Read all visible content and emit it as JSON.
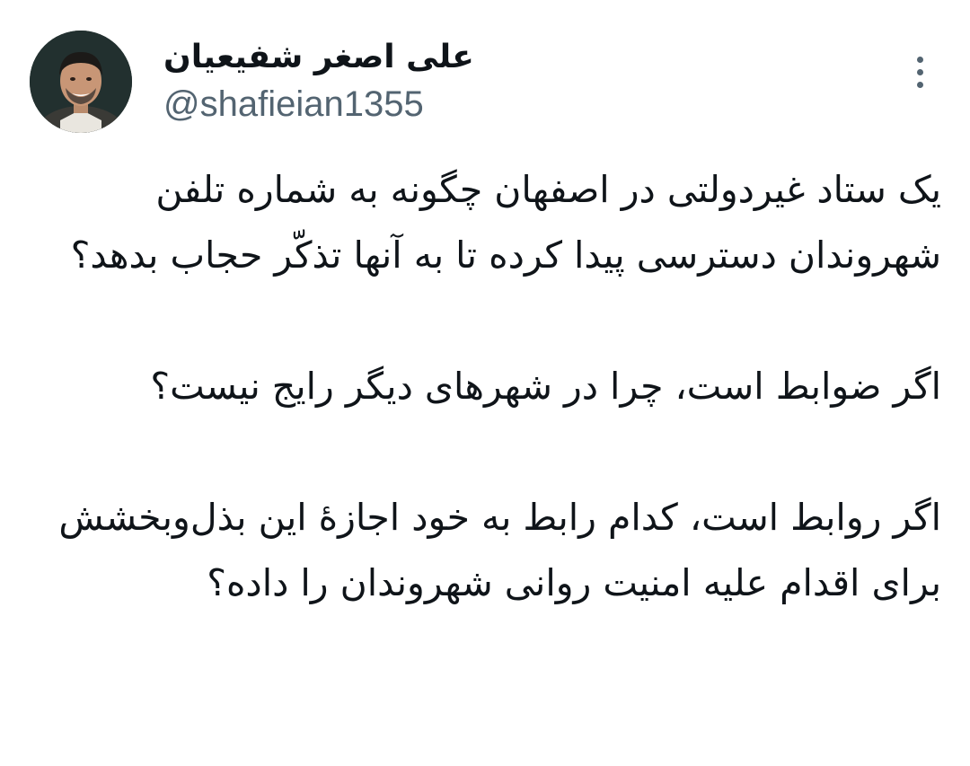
{
  "author": {
    "display_name": "علی اصغر شفیعیان",
    "handle": "@shafieian1355",
    "avatar_icon": "profile-photo"
  },
  "menu": {
    "icon": "more-vertical-icon"
  },
  "tweet": {
    "paragraphs": [
      "یک ستاد غیردولتی در اصفهان چگونه به شماره تلفن شهروندان دسترسی پیدا کرده تا به آنها تذکّر حجاب بدهد؟",
      "اگر ضوابط است، چرا در شهرهای دیگر رایج نیست؟",
      "اگر روابط است، کدام رابط به خود اجازهٔ این بذل‌وبخشش برای اقدام علیه امنیت روانی شهروندان را داده؟"
    ]
  },
  "colors": {
    "text_primary": "#0f1419",
    "text_secondary": "#536471",
    "background": "#ffffff"
  }
}
